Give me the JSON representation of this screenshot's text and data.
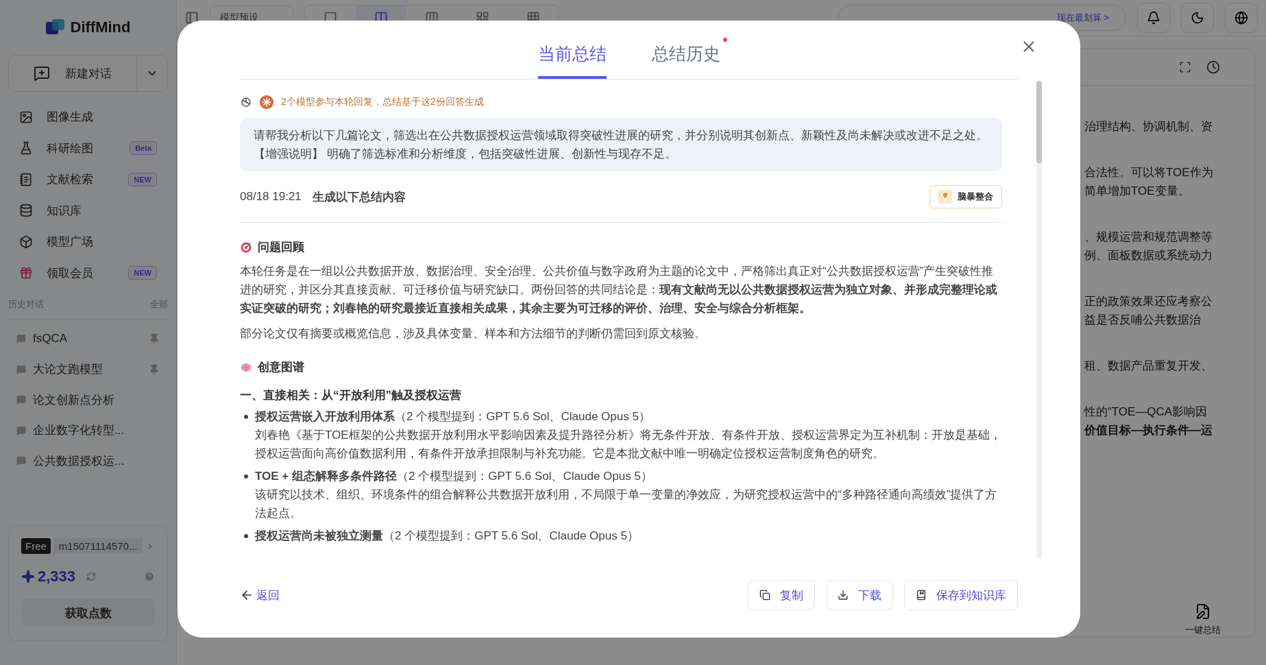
{
  "app": {
    "logo": "DiffMind"
  },
  "sidebar": {
    "new_chat": "新建对话",
    "nav": [
      {
        "label": "图像生成"
      },
      {
        "label": "科研绘图",
        "badge": "Beta"
      },
      {
        "label": "文献检索",
        "badge": "NEW"
      },
      {
        "label": "知识库"
      },
      {
        "label": "模型广场"
      },
      {
        "label": "领取会员",
        "badge": "NEW"
      }
    ],
    "history_title": "历史对话",
    "history_all": "全部",
    "history": [
      {
        "label": "fsQCA",
        "pinned": true
      },
      {
        "label": "大论文跑模型",
        "pinned": true
      },
      {
        "label": "论文创新点分析",
        "pinned": false
      },
      {
        "label": "企业数字化转型...",
        "pinned": false
      },
      {
        "label": "公共数据授权运...",
        "pinned": false
      }
    ],
    "account": {
      "plan": "Free",
      "user": "m15071114570...",
      "points": "2,333",
      "get_points": "获取点数"
    }
  },
  "topbar": {
    "preset": "模型预设",
    "layouts": [
      {
        "selected": false
      },
      {
        "selected": true
      },
      {
        "selected": false
      },
      {
        "selected": false
      },
      {
        "selected": false
      }
    ],
    "promo": "现在最划算 >"
  },
  "right_panel": {
    "paragraphs": [
      [
        {
          "text": "治理结构、协调机制、资",
          "bold": false
        }
      ],
      [
        {
          "text": "合法性。可以将TOE作为",
          "bold": false
        },
        {
          "text": "简单增加TOE变量。",
          "bold": false
        }
      ],
      [
        {
          "text": "、规模运营和规范调整等",
          "bold": false
        },
        {
          "text": "例、面板数据或系统动力",
          "bold": false
        }
      ],
      [
        {
          "text": "正的政策效果还应考察公",
          "bold": false
        },
        {
          "text": "益是否反哺公共数据治",
          "bold": false
        }
      ],
      [
        {
          "text": "租、数据产品重复开发、",
          "bold": false
        }
      ],
      [
        {
          "text": "性的“TOE—QCA影响因",
          "bold": false
        },
        {
          "text": "价值目标—执行条件—运",
          "bold": true
        }
      ]
    ],
    "summary_button": "一键总结"
  },
  "modal": {
    "tabs": [
      {
        "label": "当前总结",
        "selected": true,
        "dot": false
      },
      {
        "label": "总结历史",
        "selected": false,
        "dot": true
      }
    ],
    "models_note": "2个模型参与本轮回复，总结基于这2份回答生成",
    "prompt": [
      "请帮我分析以下几篇论文，筛选出在公共数据授权运营领域取得突破性进展的研究，并分别说明其创新点、新颖性及尚未解决或改进不足之处。",
      "【增强说明】 明确了筛选标准和分析维度，包括突破性进展、创新性与现存不足。"
    ],
    "time": "08/18 19:21",
    "heading": "生成以下总结内容",
    "brainstorm": "脑暴整合",
    "sections": [
      {
        "kind": "heading",
        "text": "问题回顾"
      },
      {
        "kind": "paragraph",
        "text": "本轮任务是在一组以公共数据开放、数据治理、安全治理、公共价值与数字政府为主题的论文中，严格筛出真正对“公共数据授权运营”产生突破性推进的研究，并区分其直接贡献、可迁移价值与研究缺口。两份回答的共同结论是：**现有文献尚无以公共数据授权运营为独立对象、并形成完整理论或实证突破的研究；刘春艳的研究最接近直接相关成果，其余主要为可迁移的评价、治理、安全与综合分析框架。**"
      },
      {
        "kind": "paragraph",
        "text": "部分论文仅有摘要或概览信息，涉及具体变量、样本和方法细节的判断仍需回到原文核验。"
      },
      {
        "kind": "heading",
        "text": "创意图谱"
      },
      {
        "kind": "subheading",
        "text": "一、直接相关：从“开放利用”触及授权运营"
      },
      {
        "kind": "bullet",
        "title": "授权运营嵌入开放利用体系",
        "note": "（2 个模型提到：GPT 5.6 Sol、Claude Opus 5）",
        "body": "刘春艳《基于TOE框架的公共数据开放利用水平影响因素及提升路径分析》将无条件开放、有条件开放、授权运营界定为互补机制：开放是基础，授权运营面向高价值数据利用，有条件开放承担限制与补充功能。它是本批文献中唯一明确定位授权运营制度角色的研究。"
      },
      {
        "kind": "bullet",
        "title": "TOE + 组态解释多条件路径",
        "note": "（2 个模型提到：GPT 5.6 Sol、Claude Opus 5）",
        "body": "该研究以技术、组织、环境条件的组合解释公共数据开放利用，不局限于单一变量的净效应，为研究授权运营中的“多种路径通向高绩效”提供了方法起点。"
      },
      {
        "kind": "bullet",
        "title": "授权运营尚未被独立测量",
        "note": "（2 个模型提到：GPT 5.6 Sol、Claude Opus 5）"
      }
    ],
    "back": "返回",
    "actions": [
      "复制",
      "下载",
      "保存到知识库"
    ]
  }
}
